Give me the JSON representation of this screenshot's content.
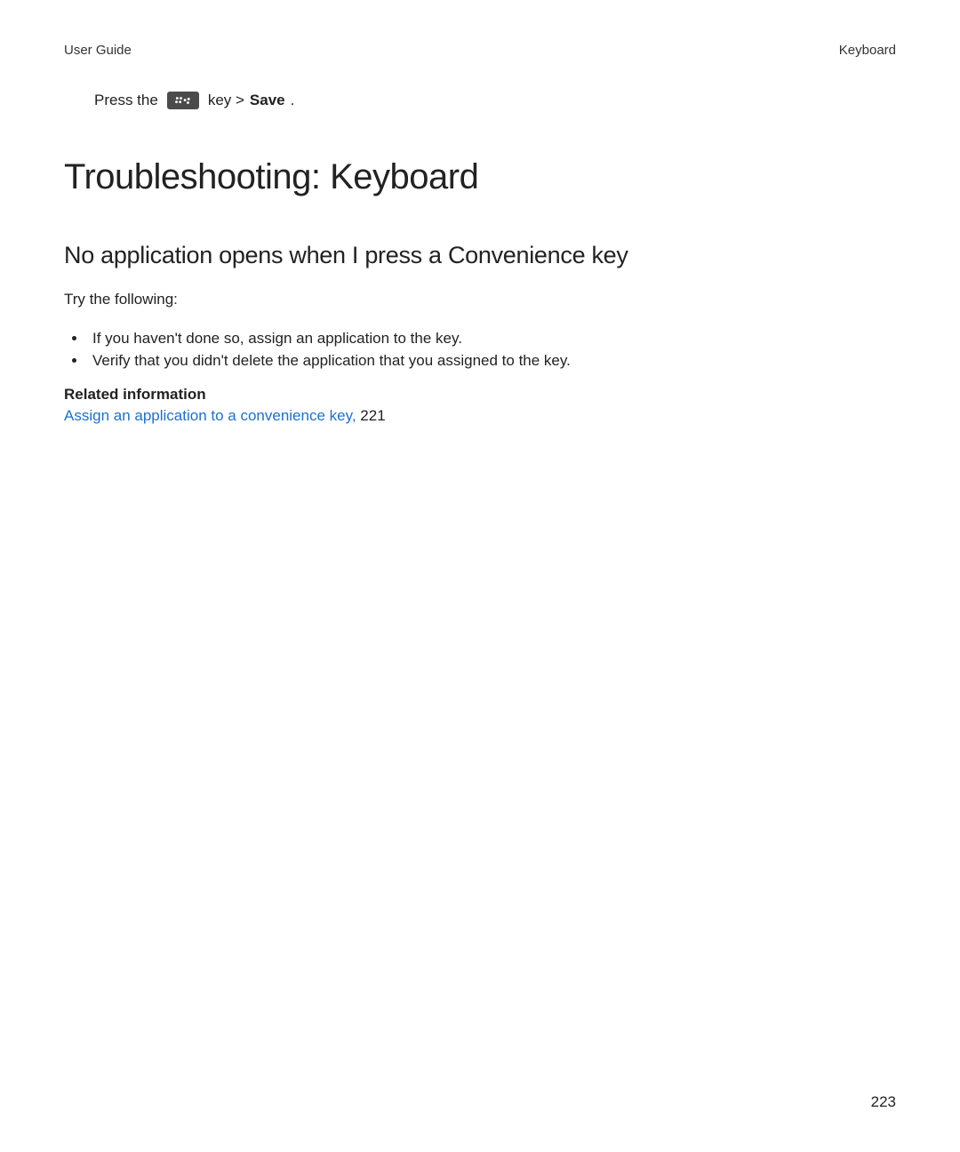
{
  "header": {
    "left": "User Guide",
    "right": "Keyboard"
  },
  "instruction": {
    "press_the": "Press the",
    "icon_name": "menu-key-icon",
    "key_gt": "key >",
    "save": "Save",
    "period": "."
  },
  "title": "Troubleshooting: Keyboard",
  "subtitle": "No application opens when I press a Convenience key",
  "lead": "Try the following:",
  "bullets": [
    "If you haven't done so, assign an application to the key.",
    "Verify that you didn't delete the application that you assigned to the key."
  ],
  "related": {
    "heading": "Related information",
    "link_text": "Assign an application to a convenience key,",
    "page_ref": " 221"
  },
  "page_number": "223"
}
